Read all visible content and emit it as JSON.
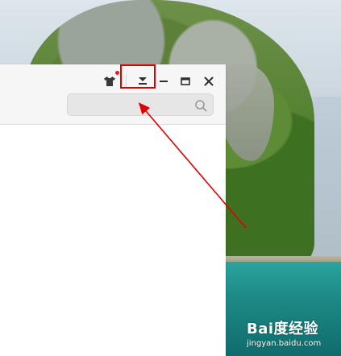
{
  "window": {
    "controls": {
      "skin": "skin-icon",
      "menu": "dropdown-menu-icon",
      "minimize": "minimize-icon",
      "maximize": "maximize-icon",
      "close": "close-icon"
    },
    "search": {
      "value": "",
      "placeholder": ""
    }
  },
  "annotation": {
    "color": "#e00000"
  },
  "watermark": {
    "text": "Bai度经验",
    "url": "jingyan.baidu.com"
  }
}
